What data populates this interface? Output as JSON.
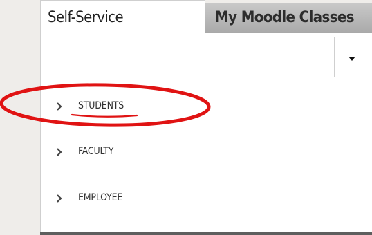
{
  "tabs": [
    {
      "label": "Self-Service",
      "active": true
    },
    {
      "label": "My Moodle Classes",
      "active": false
    }
  ],
  "dropdown": {
    "icon": "caret-down-icon"
  },
  "menu": {
    "items": [
      {
        "label": "STUDENTS",
        "icon": "chevron-right-icon"
      },
      {
        "label": "FACULTY",
        "icon": "chevron-right-icon"
      },
      {
        "label": "EMPLOYEE",
        "icon": "chevron-right-icon"
      }
    ]
  },
  "annotation": {
    "color": "#e01313",
    "shape": "ellipse-with-underline"
  },
  "colors": {
    "active_tab_bg": "#ffffff",
    "inactive_tab_bg": "#b3b3b3",
    "page_bg": "#efedea",
    "text": "#333333"
  }
}
